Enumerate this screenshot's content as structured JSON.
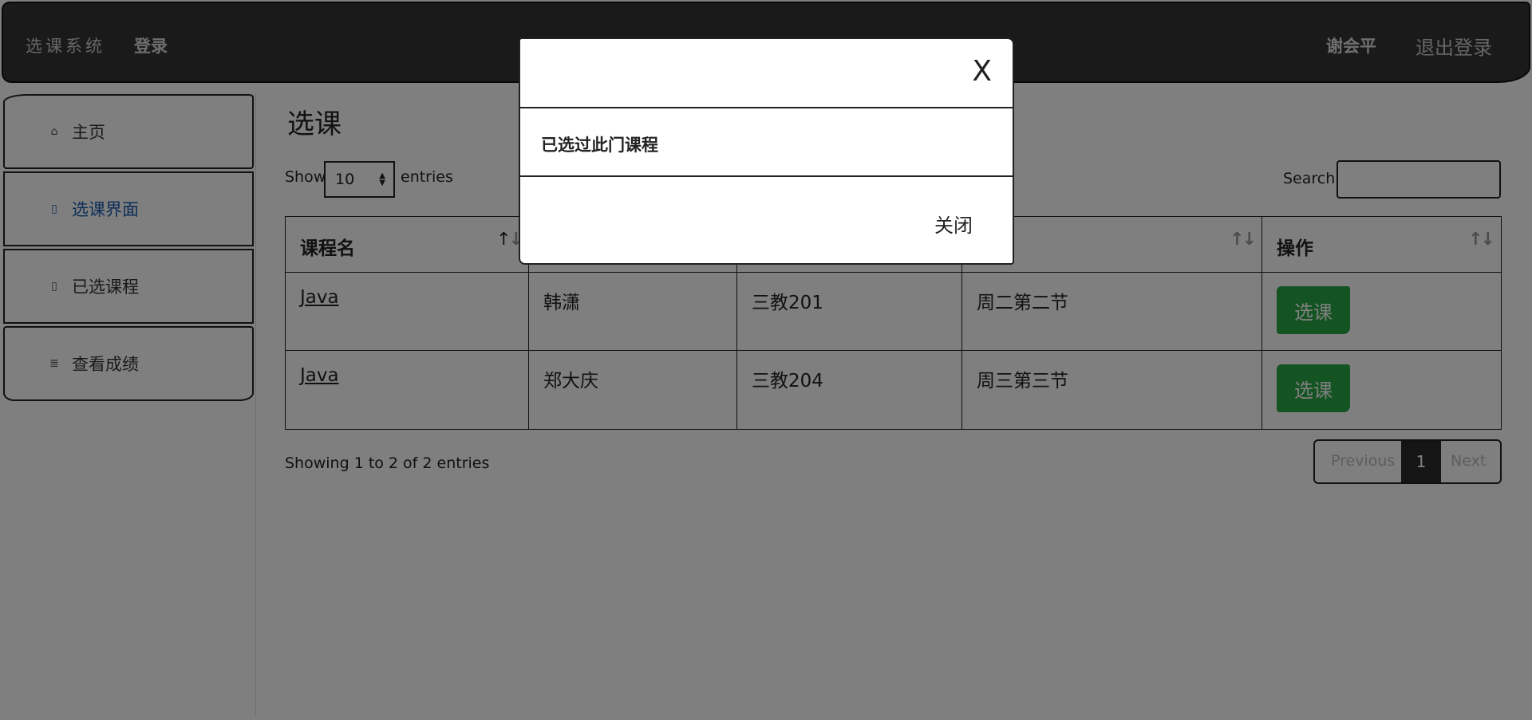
{
  "navbar": {
    "brand": "选课系统",
    "login": "登录",
    "user": "谢会平",
    "logout": "退出登录"
  },
  "sidebar": {
    "items": [
      {
        "label": "主页",
        "icon": "home-icon"
      },
      {
        "label": "选课界面",
        "icon": "book-icon",
        "active": true
      },
      {
        "label": "已选课程",
        "icon": "book-icon"
      },
      {
        "label": "查看成绩",
        "icon": "list-icon"
      }
    ]
  },
  "main": {
    "title": "选课",
    "show_label": "Show",
    "entries_value": "10",
    "entries_label": "entries",
    "search_label": "Search:",
    "search_value": "",
    "table": {
      "headers": [
        "课程名",
        "",
        "",
        "",
        "操作"
      ],
      "rows": [
        {
          "course": "Java",
          "teacher": "韩潇",
          "room": "三教201",
          "time": "周二第二节",
          "action": "选课"
        },
        {
          "course": "Java",
          "teacher": "郑大庆",
          "room": "三教204",
          "time": "周三第三节",
          "action": "选课"
        }
      ]
    },
    "info": "Showing 1 to 2 of 2 entries",
    "pagination": {
      "previous": "Previous",
      "current": "1",
      "next": "Next"
    }
  },
  "modal": {
    "close_x": "X",
    "message": "已选过此门课程",
    "close_button": "关闭"
  },
  "colors": {
    "navbar": "#343434",
    "select_button": "#28a745",
    "active_link": "#1a5cb0"
  }
}
